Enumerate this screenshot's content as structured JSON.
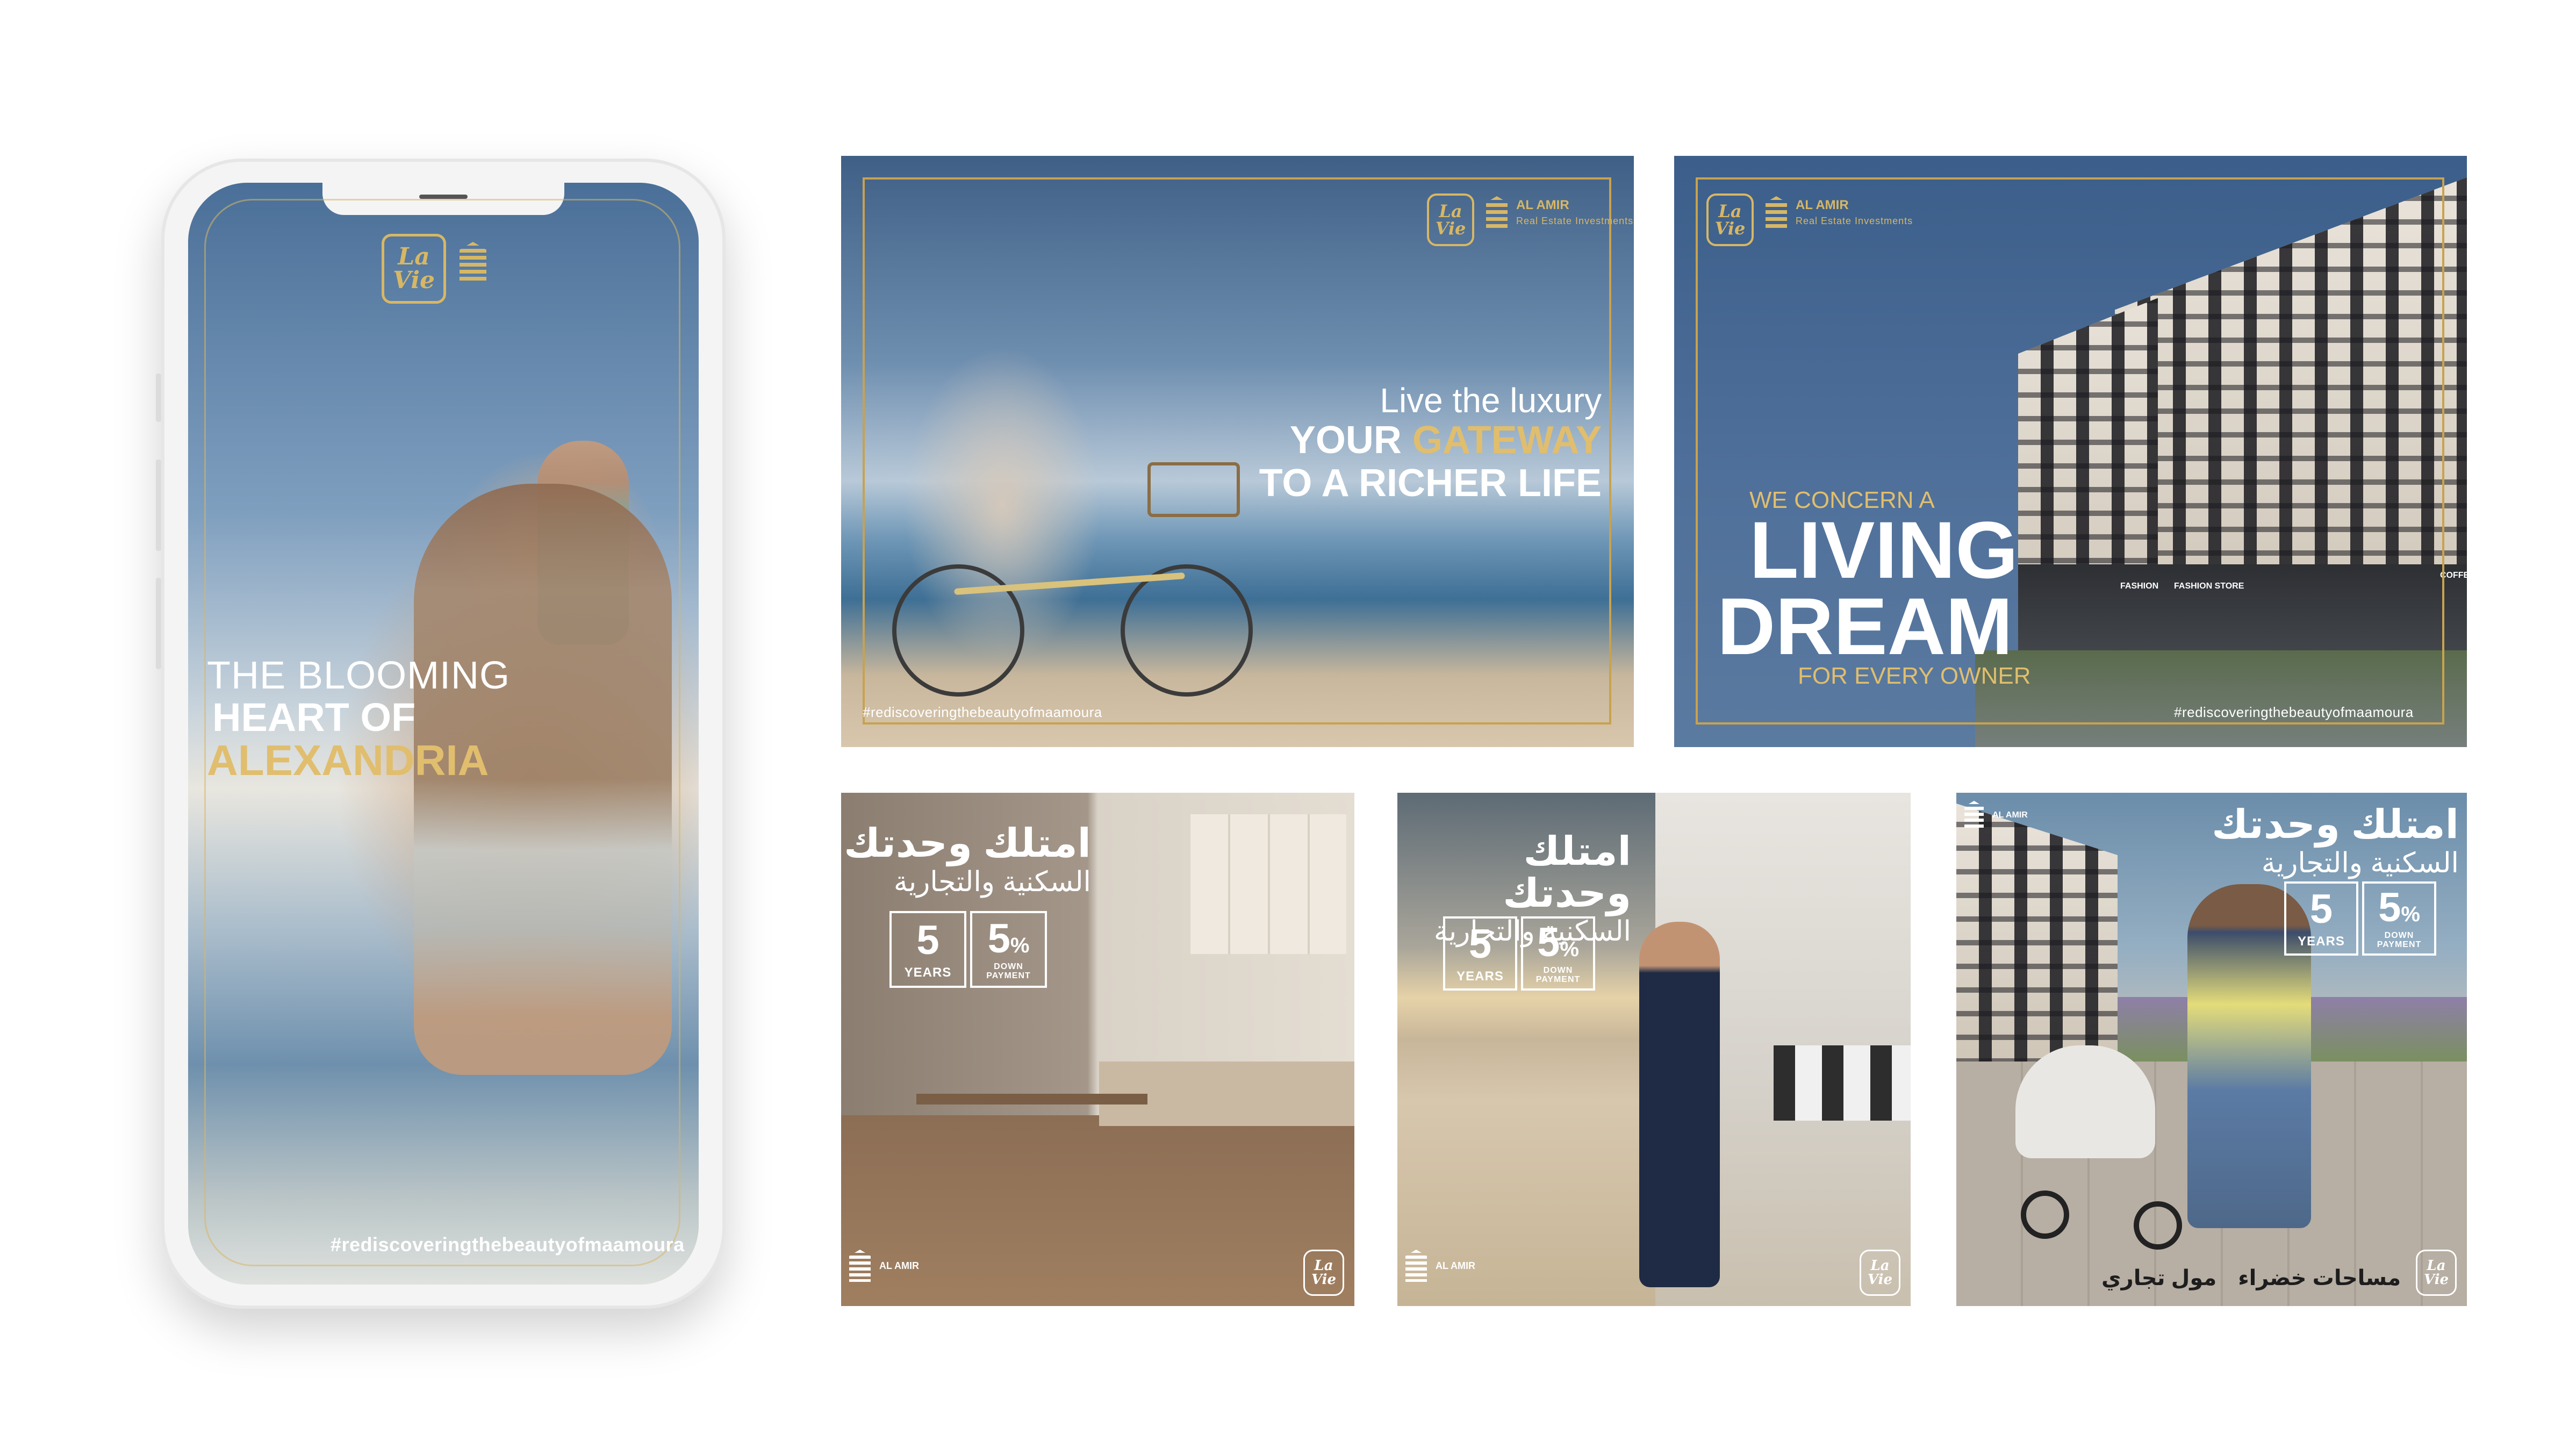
{
  "phone_ad": {
    "headline": [
      "THE BLOOMING",
      "HEART OF",
      "ALEXANDRIA"
    ],
    "hashtag": "#rediscoveringthebeautyofmaamoura",
    "logo_text": "La Vie"
  },
  "banner_bike": {
    "line1": "Live the luxury",
    "line2_white": "YOUR",
    "line2_gold": "GATEWAY",
    "line3": "TO A RICHER LIFE",
    "hashtag": "#rediscoveringthebeautyofmaamoura",
    "brand_name": "AL AMIR",
    "brand_sub": "Real Estate Investments"
  },
  "banner_building": {
    "kicker": "WE CONCERN A",
    "big1": "LIVING",
    "big2": "DREAM",
    "tagline": "FOR EVERY OWNER",
    "hashtag": "#rediscoveringthebeautyofmaamoura",
    "brand_name": "AL AMIR",
    "brand_sub": "Real Estate Investments",
    "store_labels": [
      "FASHION",
      "FASHION STORE",
      "COFFEE"
    ]
  },
  "square_kitchen": {
    "title": "امتلك وحدتك",
    "subtitle": "السكنية والتجارية",
    "years": "5",
    "years_label": "YEARS",
    "down": "5",
    "down_unit": "%",
    "down_label": "DOWN PAYMENT",
    "brand_name": "AL AMIR"
  },
  "square_office": {
    "title": "امتلك وحدتك",
    "subtitle": "السكنية والتجارية",
    "years": "5",
    "years_label": "YEARS",
    "down": "5",
    "down_unit": "%",
    "down_label": "DOWN PAYMENT",
    "brand_name": "AL AMIR"
  },
  "square_family": {
    "title": "امتلك وحدتك",
    "subtitle": "السكنية والتجارية",
    "years": "5",
    "years_label": "YEARS",
    "down": "5",
    "down_unit": "%",
    "down_label": "DOWN PAYMENT",
    "feature1": "مساحات خضراء",
    "feature2": "مول تجاري",
    "brand_name": "AL AMIR"
  },
  "colors": {
    "gold": "#d7b765",
    "blue": "#3f5f86",
    "background": "#ffffff"
  }
}
